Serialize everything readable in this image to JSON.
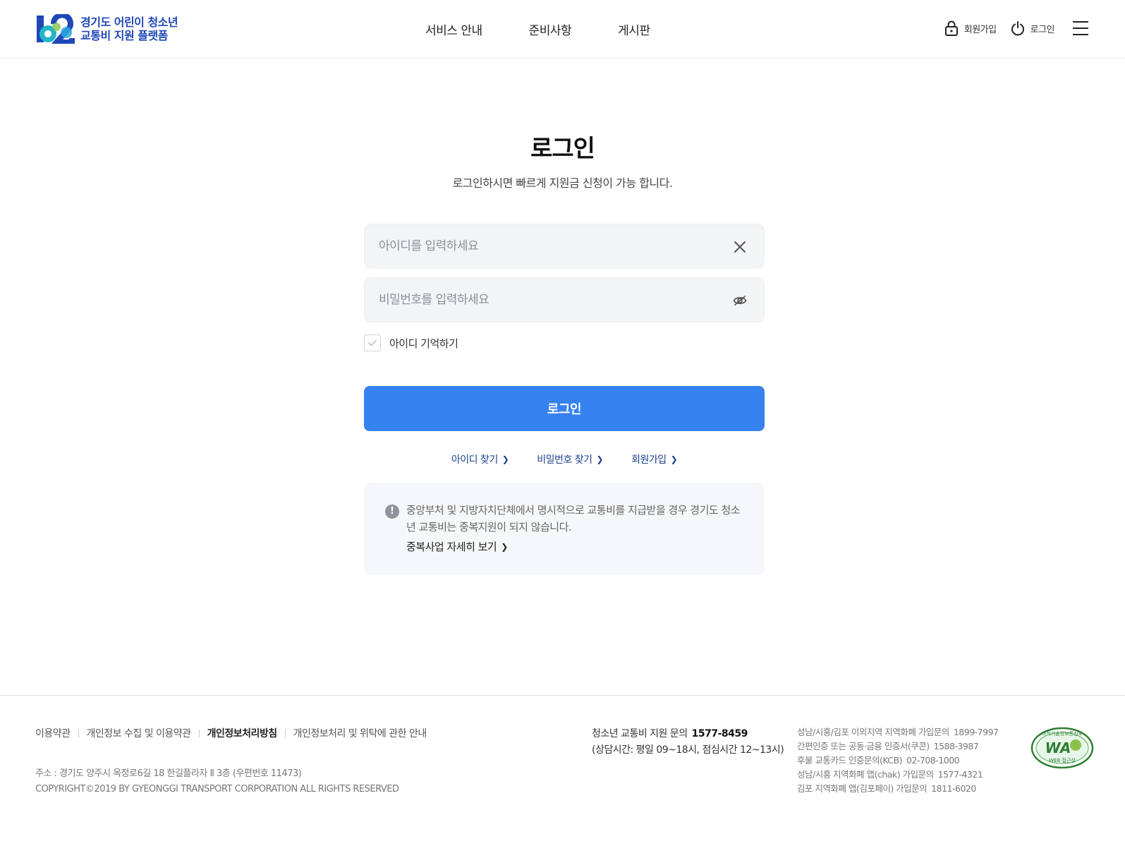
{
  "header": {
    "logo_line1": "경기도 어린이 청소년",
    "logo_line2": "교통비 지원 플랫폼",
    "nav": [
      "서비스 안내",
      "준비사항",
      "게시판"
    ],
    "signup_label": "회원가입",
    "login_label": "로그인"
  },
  "main": {
    "title": "로그인",
    "subtitle": "로그인하시면 빠르게  지원금 신청이 가능 합니다.",
    "id_placeholder": "아이디를 입력하세요",
    "id_value": "",
    "pw_placeholder": "비밀번호를 입력하세요",
    "pw_value": "",
    "remember_label": "아이디 기억하기",
    "remember_checked": false,
    "login_button": "로그인",
    "links": [
      "아이디 찾기",
      "비밀번호 찾기",
      "회원가입"
    ],
    "notice_text": "중앙부처 및 지방자치단체에서 명시적으로 교통비를 지급받을 경우 경기도 청소년 교통비는 중복지원이 되지 않습니다.",
    "notice_link": "중복사업 자세히 보기"
  },
  "footer": {
    "links": [
      "이용약관",
      "개인정보 수집 및 이용약관",
      "개인정보처리방침",
      "개인정보처리 및 위탁에 관한 안내"
    ],
    "address": "주소 : 경기도 양주시 옥정로6길 18 한길플라자 Ⅱ 3층 (우편번호 11473)",
    "copyright": "COPYRIGHT©2019 BY GYEONGGI TRANSPORT CORPORATION ALL RIGHTS RESERVED",
    "contact_label": "청소년 교통비 지원 문의",
    "contact_number": "1577-8459",
    "contact_hours": "(상담시간: 평일 09~18시, 점심시간 12~13시)",
    "contact_list": [
      {
        "label": "성남/시흥/김포 이외지역 지역화폐 가입문의",
        "number": "1899-7997"
      },
      {
        "label": "간편인증 또는 공동·금융 인증서(쿠콘)",
        "number": "1588-3987"
      },
      {
        "label": "후불 교통카드 인증문의(KCB)",
        "number": "02-708-1000"
      },
      {
        "label": "성남/시흥 지역화폐 앱(chak) 가입문의",
        "number": "1577-4321"
      },
      {
        "label": "김포 지역화폐 앱(김포페이) 가입문의",
        "number": "1811-6020"
      }
    ],
    "wa_mark_top": "과학기술정보통신부",
    "wa_mark_center": "WA",
    "wa_mark_bottom": "WEB 접근성"
  },
  "colors": {
    "brand_blue": "#1f47b8",
    "primary_button": "#3582f0",
    "link_blue": "#1b3f8f"
  },
  "icons": {
    "lock": "lock-icon",
    "power": "power-icon",
    "menu": "hamburger-menu-icon",
    "clear": "close-icon",
    "eye": "eye-slash-icon",
    "check": "check-icon",
    "notice": "exclamation-icon",
    "chevron": "chevron-right-icon"
  }
}
